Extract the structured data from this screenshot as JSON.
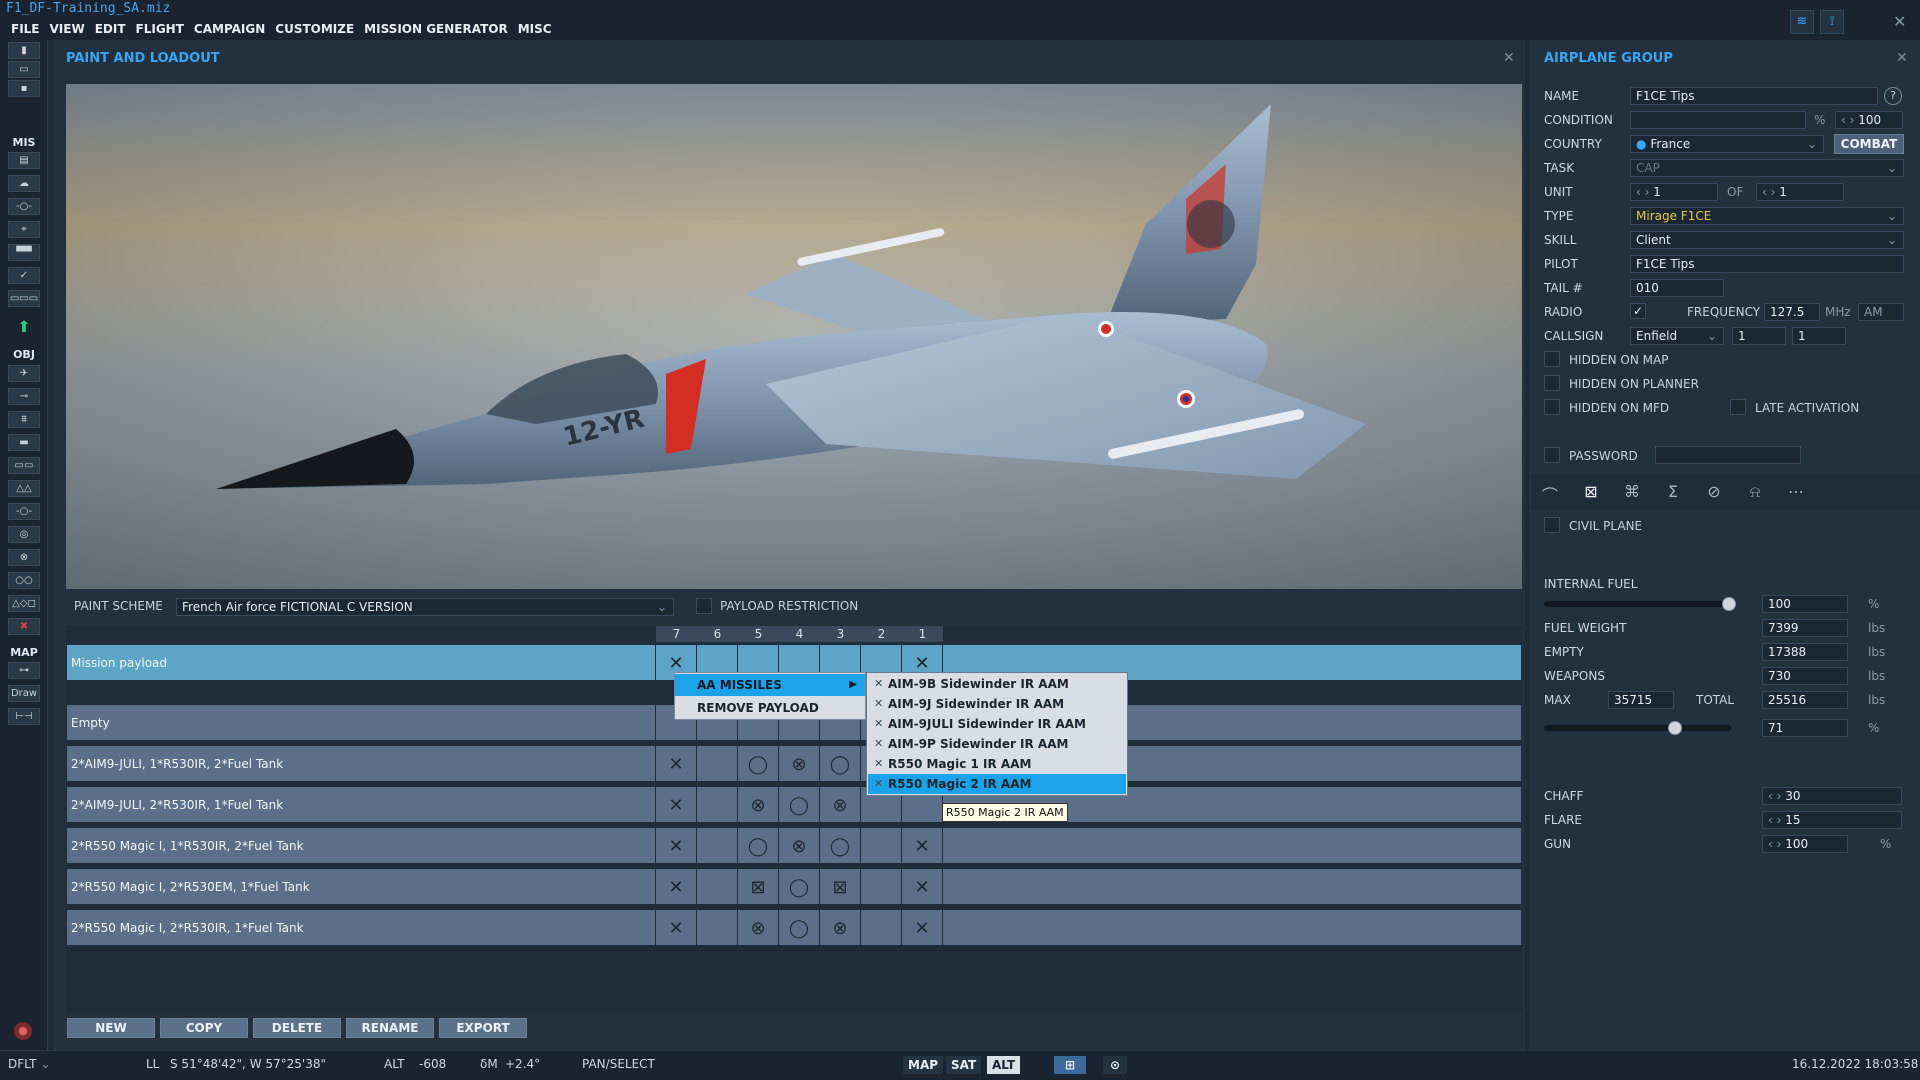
{
  "window": {
    "file_title": "F1_DF-Training_SA.miz"
  },
  "menu": [
    "FILE",
    "VIEW",
    "EDIT",
    "FLIGHT",
    "CAMPAIGN",
    "CUSTOMIZE",
    "MISSION GENERATOR",
    "MISC"
  ],
  "toolbar": {
    "section_mis": "MIS",
    "section_obj": "OBJ",
    "section_map": "MAP",
    "draw_label": "Draw"
  },
  "paint_loadout": {
    "title": "PAINT AND LOADOUT",
    "plane_image_text": "12-YR",
    "paint_scheme_label": "PAINT SCHEME",
    "paint_scheme_value": "French Air force FICTIONAL C VERSION",
    "payload_restriction_label": "PAYLOAD RESTRICTION",
    "stations": [
      "7",
      "6",
      "5",
      "4",
      "3",
      "2",
      "1"
    ],
    "payloads": [
      {
        "name": "Mission payload"
      },
      {
        "name": "Empty"
      },
      {
        "name": "2*AIM9-JULI, 1*R530IR, 2*Fuel Tank"
      },
      {
        "name": "2*AIM9-JULI, 2*R530IR, 1*Fuel Tank"
      },
      {
        "name": "2*R550 Magic I, 1*R530IR, 2*Fuel Tank"
      },
      {
        "name": "2*R550 Magic I, 2*R530EM, 1*Fuel Tank"
      },
      {
        "name": "2*R550 Magic I, 2*R530IR, 1*Fuel Tank"
      }
    ],
    "context_menu": {
      "aa_missiles": "AA MISSILES",
      "remove_payload": "REMOVE PAYLOAD"
    },
    "submenu": [
      "AIM-9B Sidewinder IR AAM",
      "AIM-9J Sidewinder IR AAM",
      "AIM-9JULI Sidewinder IR AAM",
      "AIM-9P Sidewinder IR AAM",
      "R550 Magic 1 IR AAM",
      "R550 Magic 2 IR AAM"
    ],
    "submenu_selected_index": 5,
    "tooltip": "R550 Magic 2 IR AAM",
    "buttons": {
      "new": "NEW",
      "copy": "COPY",
      "delete": "DELETE",
      "rename": "RENAME",
      "export": "EXPORT"
    }
  },
  "airplane_group": {
    "title": "AIRPLANE GROUP",
    "name_label": "NAME",
    "name_value": "F1CE Tips",
    "help": "?",
    "condition_label": "CONDITION",
    "condition_pct": "%",
    "condition_value": "100",
    "country_label": "COUNTRY",
    "country_value": "France",
    "combat_button": "COMBAT",
    "task_label": "TASK",
    "task_value": "CAP",
    "unit_label": "UNIT",
    "unit_value": "1",
    "unit_of": "OF",
    "unit_total": "1",
    "type_label": "TYPE",
    "type_value": "Mirage F1CE",
    "skill_label": "SKILL",
    "skill_value": "Client",
    "pilot_label": "PILOT",
    "pilot_value": "F1CE Tips",
    "tail_label": "TAIL #",
    "tail_value": "010",
    "radio_label": "RADIO",
    "frequency_label": "FREQUENCY",
    "frequency_value": "127.5",
    "mhz": "MHz",
    "modulation": "AM",
    "callsign_label": "CALLSIGN",
    "callsign_value": "Enfield",
    "callsign_n1": "1",
    "callsign_n2": "1",
    "hidden_map": "HIDDEN ON MAP",
    "hidden_planner": "HIDDEN ON PLANNER",
    "hidden_mfd": "HIDDEN ON MFD",
    "late_activation": "LATE ACTIVATION",
    "password_label": "PASSWORD",
    "civil_plane": "CIVIL PLANE",
    "internal_fuel_label": "INTERNAL FUEL",
    "internal_fuel_value": "100",
    "internal_fuel_unit": "%",
    "fuel_weight_label": "FUEL WEIGHT",
    "fuel_weight_value": "7399",
    "lbs": "lbs",
    "empty_label": "EMPTY",
    "empty_value": "17388",
    "weapons_label": "WEAPONS",
    "weapons_value": "730",
    "max_label": "MAX",
    "max_value": "35715",
    "total_label": "TOTAL",
    "total_value": "25516",
    "load_pct_value": "71",
    "pct": "%",
    "chaff_label": "CHAFF",
    "chaff_value": "30",
    "flare_label": "FLARE",
    "flare_value": "15",
    "gun_label": "GUN",
    "gun_value": "100"
  },
  "statusbar": {
    "profile": "DFLT",
    "ll_label": "LL",
    "coords": "S 51°48'42\", W 57°25'38\"",
    "alt_label": "ALT",
    "alt_value": "-608",
    "delta_m": "δM",
    "delta_value": "+2.4°",
    "mode": "PAN/SELECT",
    "map_btn": "MAP",
    "sat_btn": "SAT",
    "alt_btn": "ALT",
    "datetime": "16.12.2022 18:03:58"
  }
}
